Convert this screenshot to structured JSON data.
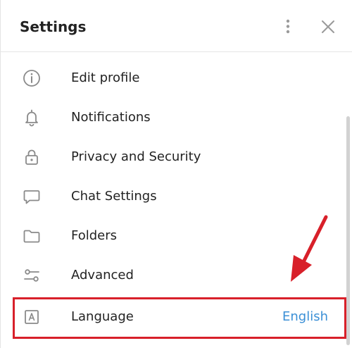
{
  "header": {
    "title": "Settings"
  },
  "menu": {
    "items": [
      {
        "id": "edit-profile",
        "label": "Edit profile",
        "icon": "info-icon"
      },
      {
        "id": "notifications",
        "label": "Notifications",
        "icon": "bell-icon"
      },
      {
        "id": "privacy",
        "label": "Privacy and Security",
        "icon": "lock-icon"
      },
      {
        "id": "chat-settings",
        "label": "Chat Settings",
        "icon": "chat-bubble-icon"
      },
      {
        "id": "folders",
        "label": "Folders",
        "icon": "folder-icon"
      },
      {
        "id": "advanced",
        "label": "Advanced",
        "icon": "sliders-icon"
      },
      {
        "id": "language",
        "label": "Language",
        "icon": "language-icon",
        "value": "English"
      }
    ]
  },
  "colors": {
    "accent": "#3a8fd6",
    "highlight": "#d8202a",
    "icon": "#8a8a8a",
    "text": "#222222"
  }
}
